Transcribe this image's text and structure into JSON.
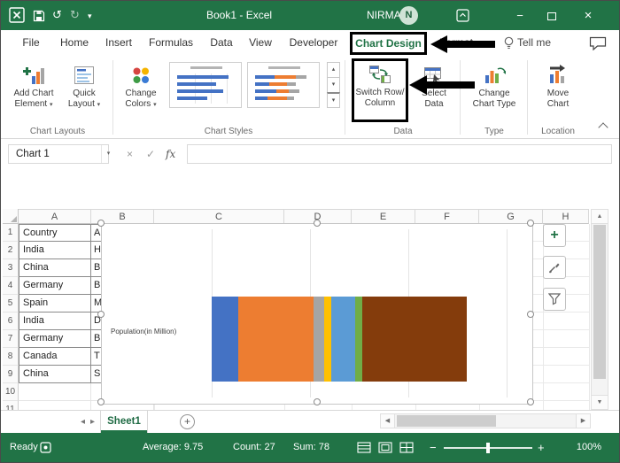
{
  "titlebar": {
    "title": "Book1 - Excel",
    "user_name": "NIRMAL",
    "avatar_initial": "N"
  },
  "tabs": {
    "file": "File",
    "home": "Home",
    "insert": "Insert",
    "formulas": "Formulas",
    "data": "Data",
    "view": "View",
    "developer": "Developer",
    "chart_design": "Chart Design",
    "format": "Format",
    "tell_me": "Tell me"
  },
  "ribbon": {
    "chart_layouts": {
      "label": "Chart Layouts",
      "add_chart_element_l1": "Add Chart",
      "add_chart_element_l2": "Element",
      "quick_layout_l1": "Quick",
      "quick_layout_l2": "Layout"
    },
    "chart_styles": {
      "label": "Chart Styles",
      "change_colors_l1": "Change",
      "change_colors_l2": "Colors"
    },
    "data_group": {
      "label": "Data",
      "switch_l1": "Switch Row/",
      "switch_l2": "Column",
      "select_l1": "Select",
      "select_l2": "Data"
    },
    "type_group": {
      "label": "Type",
      "change_type_l1": "Change",
      "change_type_l2": "Chart Type"
    },
    "location_group": {
      "label": "Location",
      "move_l1": "Move",
      "move_l2": "Chart"
    }
  },
  "formula_bar": {
    "name_box": "Chart 1",
    "formula": ""
  },
  "grid": {
    "columns": [
      "A",
      "B",
      "C",
      "D",
      "E",
      "F",
      "G",
      "H"
    ],
    "rows": [
      "1",
      "2",
      "3",
      "4",
      "5",
      "6",
      "7",
      "8",
      "9",
      "10",
      "11"
    ],
    "col_a": [
      "Country",
      "India",
      "China",
      "Germany",
      "Spain",
      "India",
      "Germany",
      "Canada",
      "China"
    ],
    "col_b_partial": [
      "A",
      "H",
      "B",
      "B",
      "M",
      "D",
      "B",
      "T",
      "S"
    ]
  },
  "chart": {
    "type": "stacked-bar",
    "category_label": "Population(in Million)",
    "segments": [
      {
        "color": "#4472C4",
        "pct": 10.4
      },
      {
        "color": "#ED7D31",
        "pct": 29.5
      },
      {
        "color": "#A5A5A5",
        "pct": 4.2
      },
      {
        "color": "#FFC000",
        "pct": 2.8
      },
      {
        "color": "#5B9BD5",
        "pct": 9.4
      },
      {
        "color": "#70AD47",
        "pct": 2.8
      },
      {
        "color": "#843C0C",
        "pct": 40.9
      }
    ]
  },
  "sheet_bar": {
    "active_tab": "Sheet1"
  },
  "status_bar": {
    "mode": "Ready",
    "average": "Average: 9.75",
    "count": "Count: 27",
    "sum": "Sum: 78",
    "zoom": "100%"
  },
  "glyphs": {
    "dropdown": "▾",
    "close": "×",
    "check": "✓",
    "fx": "fx",
    "undo": "↺",
    "redo": "↻",
    "plus": "+",
    "minus": "−",
    "up": "▲",
    "down": "▼",
    "left": "◀",
    "right": "▶",
    "nav_left": "◂",
    "nav_right": "▸",
    "gallery_up": "▴",
    "gallery_down": "▾"
  },
  "colors": {
    "excel_green": "#217346",
    "annotation": "#000000"
  }
}
